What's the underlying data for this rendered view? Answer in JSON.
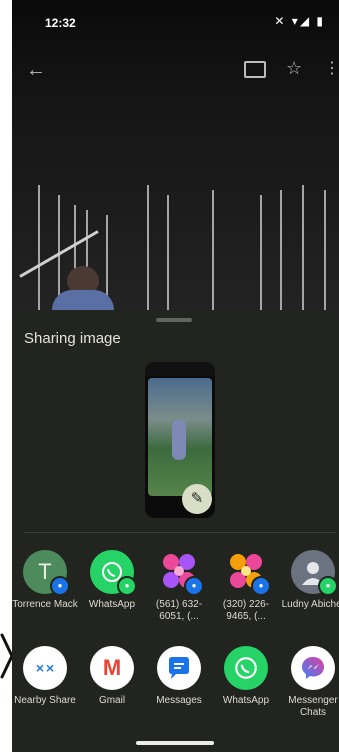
{
  "status_bar": {
    "time": "12:32",
    "icons": "✕ ▾◢ ▮"
  },
  "top_bar": {
    "back_icon": "←",
    "star_icon": "☆",
    "more_icon": "⋮"
  },
  "sheet": {
    "title": "Sharing image",
    "edit_icon": "✎",
    "direct_targets": [
      {
        "label": "Torrence Mack",
        "initial": "T",
        "avatar_color": "#4e8b5c"
      },
      {
        "label": "WhatsApp",
        "avatar_color": "#25d366"
      },
      {
        "label": "(561) 632-6051, (...",
        "avatar_color": "#ec4899"
      },
      {
        "label": "(320) 226-9465, (...",
        "avatar_color": "#f59e0b"
      },
      {
        "label": "Ludny Abichet",
        "avatar_color": "#6b7280"
      }
    ],
    "apps": [
      {
        "label": "Nearby Share",
        "icon": "⨯⨯"
      },
      {
        "label": "Gmail",
        "icon": "M"
      },
      {
        "label": "Messages",
        "icon": "💬"
      },
      {
        "label": "WhatsApp",
        "icon": "✆"
      },
      {
        "label": "Messenger Chats",
        "icon": "⚡"
      }
    ]
  }
}
